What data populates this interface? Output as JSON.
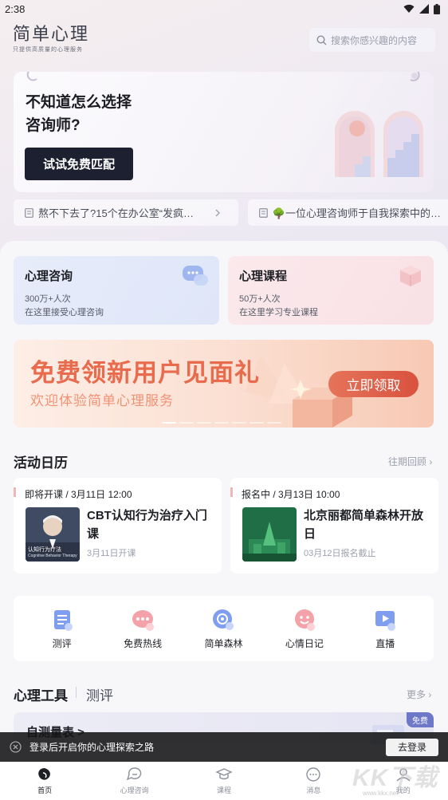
{
  "status": {
    "time": "2:38"
  },
  "header": {
    "logo_title": "简单心理",
    "logo_subtitle": "只提供高质量的心理服务",
    "search_placeholder": "搜索你感兴趣的内容"
  },
  "hero": {
    "title_line1": "不知道怎么选择",
    "title_line2": "咨询师?",
    "button_label": "试试免费匹配"
  },
  "tickers": [
    {
      "text": "熬不下去了?15个在办公室“发疯…"
    },
    {
      "text": "🌳一位心理咨询师于自我探索中的…"
    }
  ],
  "services": [
    {
      "title": "心理咨询",
      "count": "300万+人次",
      "desc": "在这里接受心理咨询"
    },
    {
      "title": "心理课程",
      "count": "50万+人次",
      "desc": "在这里学习专业课程"
    }
  ],
  "banner": {
    "title": "免费领新用户见面礼",
    "subtitle": "欢迎体验简单心理服务",
    "button_label": "立即领取"
  },
  "calendar": {
    "title": "活动日历",
    "more": "往期回顾",
    "events": [
      {
        "tag": "即将开课 / 3月11日 12:00",
        "name": "CBT认知行为治疗入门课",
        "meta": "3月11日开课",
        "img_caption": "认知行为疗法",
        "img_caption2": "Cognitive Behavior Therapy"
      },
      {
        "tag": "报名中 / 3月13日 10:00",
        "name": "北京丽都简单森林开放日",
        "meta": "03月12日报名截止"
      }
    ]
  },
  "shortcuts": [
    {
      "label": "测评",
      "icon": "clipboard-icon"
    },
    {
      "label": "免费热线",
      "icon": "chat-bubble-icon"
    },
    {
      "label": "简单森林",
      "icon": "forest-icon"
    },
    {
      "label": "心情日记",
      "icon": "mood-face-icon"
    },
    {
      "label": "直播",
      "icon": "live-play-icon"
    }
  ],
  "tools": {
    "title": "心理工具",
    "tab2": "测评",
    "more": "更多",
    "card_title": "自测量表 >",
    "badge": "免费"
  },
  "login_bar": {
    "text": "登录后开启你的心理探索之路",
    "button": "去登录"
  },
  "tabbar": [
    {
      "label": "首页",
      "icon": "home-icon",
      "active": true
    },
    {
      "label": "心理咨询",
      "icon": "consult-icon"
    },
    {
      "label": "课程",
      "icon": "course-cap-icon"
    },
    {
      "label": "消息",
      "icon": "message-icon"
    },
    {
      "label": "我的",
      "icon": "profile-icon"
    }
  ],
  "watermark": {
    "text": "KK下载",
    "url": "www.kkx.net"
  },
  "colors": {
    "primary_dark": "#1c2030",
    "banner_accent": "#e86b4d",
    "consult_card": "#e6ebf9",
    "course_card": "#fbe7ea"
  }
}
